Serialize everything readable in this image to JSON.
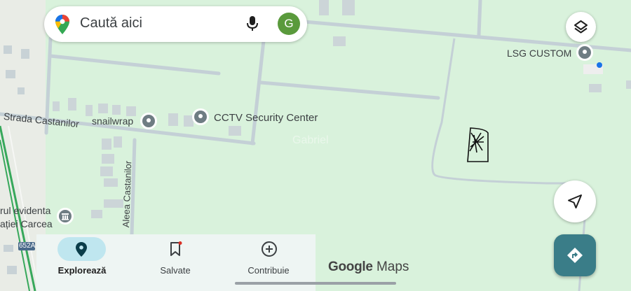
{
  "search": {
    "placeholder": "Caută aici",
    "avatar_letter": "G"
  },
  "map_labels": {
    "strada_castanilor": "Strada Castanilor",
    "snailwrap": "snailwrap",
    "cctv": "CCTV Security Center",
    "lsg": "LSG CUSTOM",
    "gabriel": "Gabriel",
    "aleea": "Aleea Castanilor",
    "evidenta_line1": "rul evidenta",
    "evidenta_line2": "ației Carcea",
    "road_shield": "652A"
  },
  "bottom_nav": {
    "explore": "Explorează",
    "saved": "Salvate",
    "contribute": "Contribuie"
  },
  "logo": {
    "google": "Google",
    "maps": "Maps"
  },
  "colors": {
    "map_bg": "#d9f2dc",
    "road": "#c4d0d6",
    "pin": "#6f7d83",
    "accent": "#3a7d88",
    "active_pill": "#bfe6ef",
    "location_dot": "#1a73e8",
    "highway": "#37a85b"
  },
  "icons": [
    "google-maps-pin-icon",
    "microphone-icon",
    "layers-icon",
    "navigation-arrow-icon",
    "directions-icon",
    "explore-pin-icon",
    "bookmark-icon",
    "add-circle-icon",
    "place-pin-icon",
    "government-building-icon"
  ]
}
